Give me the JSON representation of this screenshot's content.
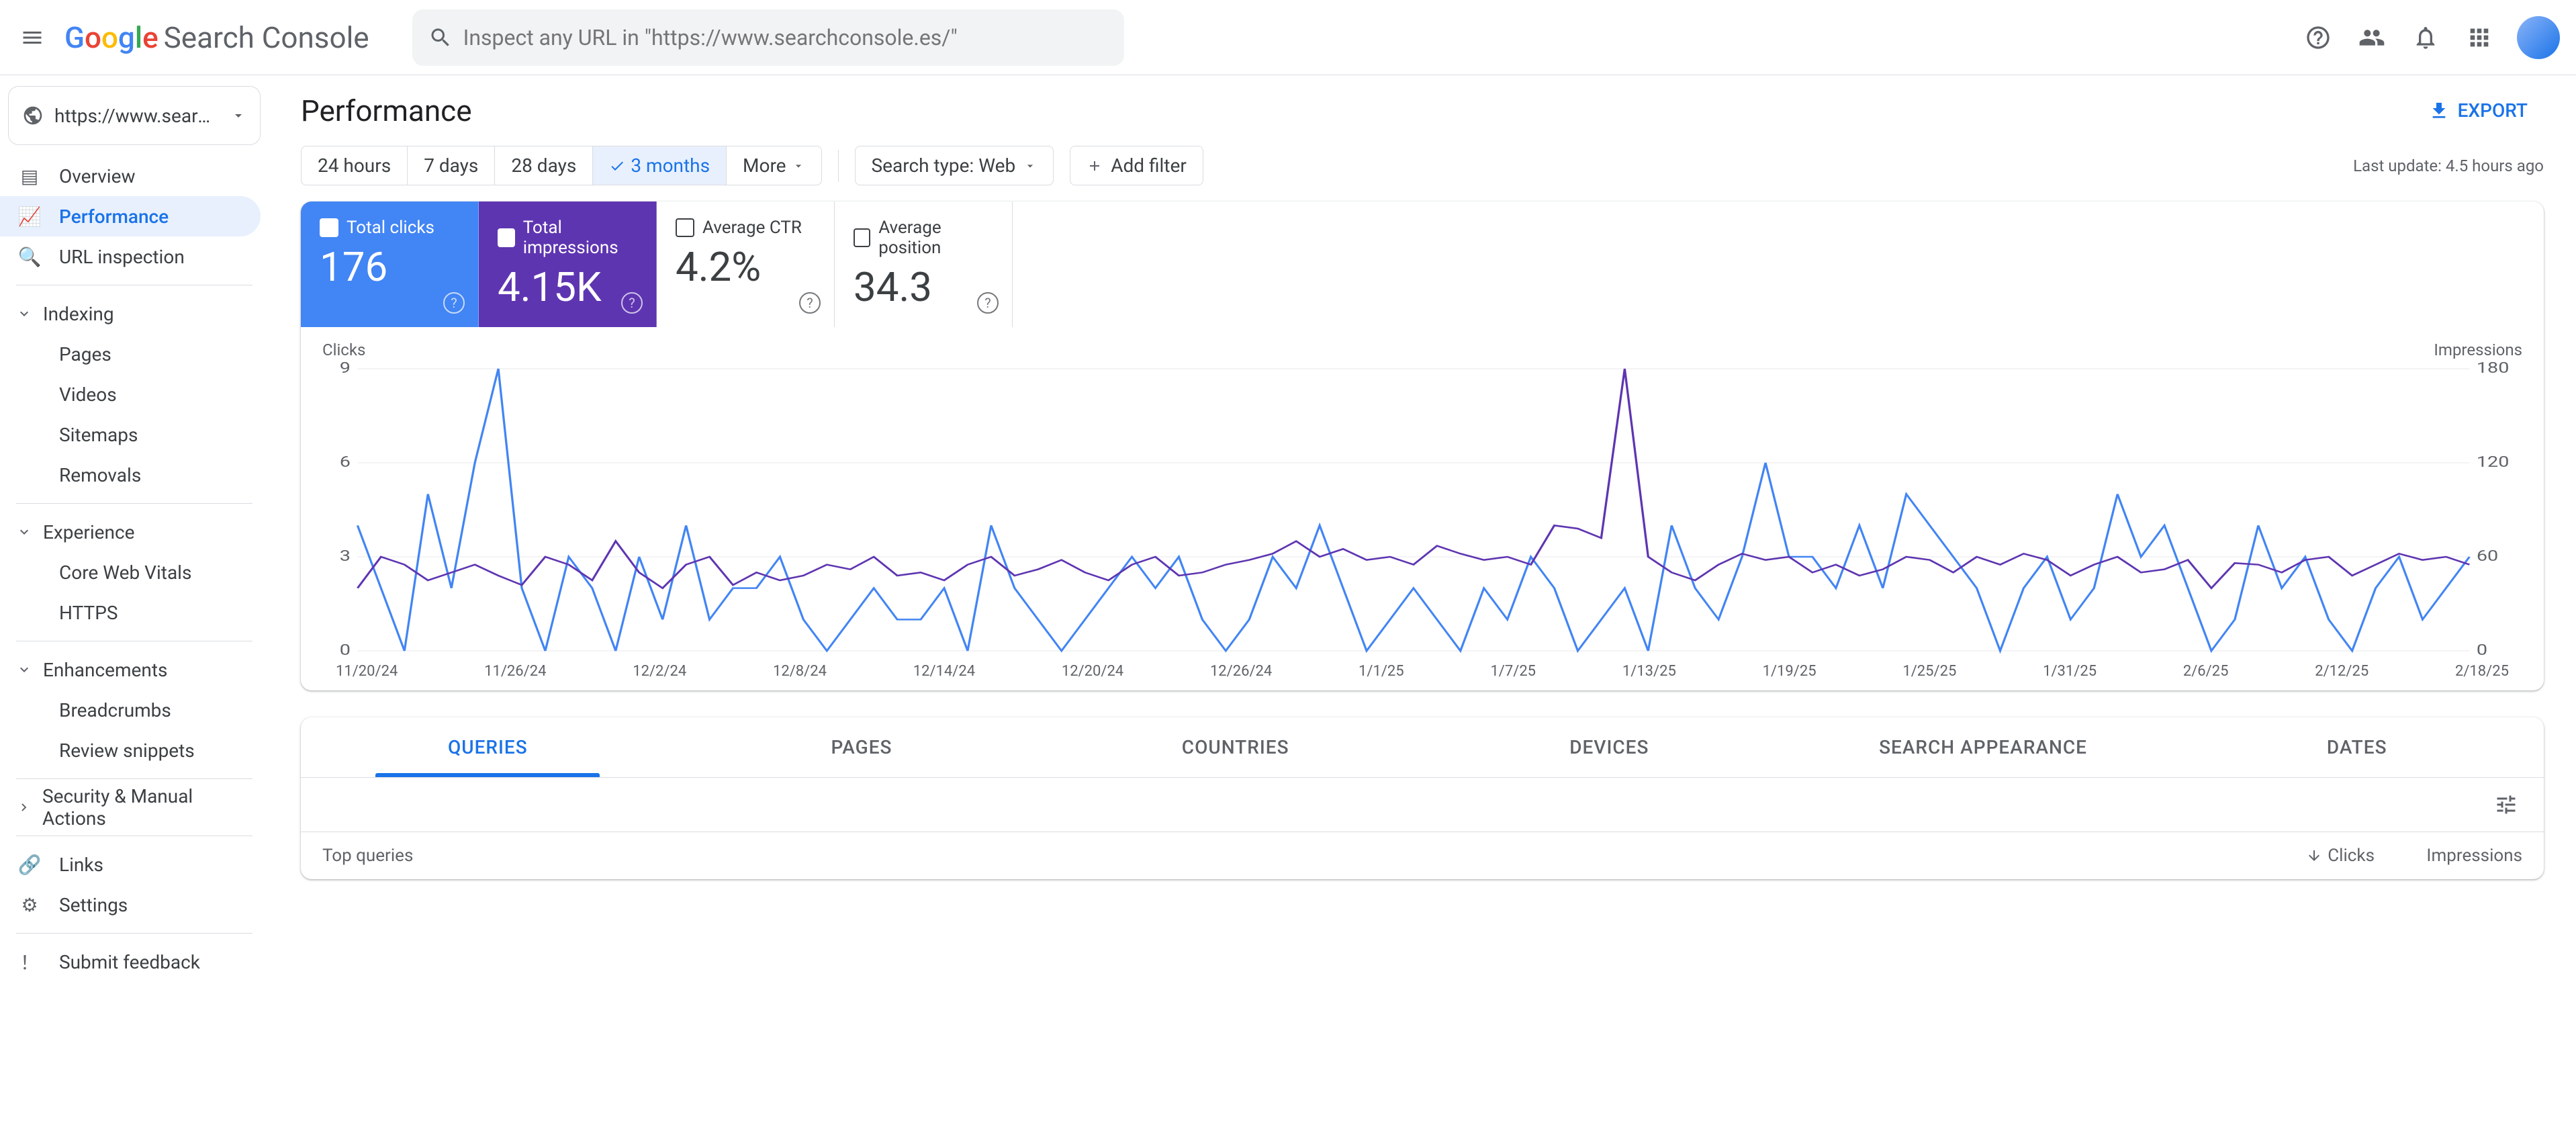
{
  "app_name": "Search Console",
  "search_placeholder": "Inspect any URL in \"https://www.searchconsole.es/\"",
  "property": "https://www.searchconsol...",
  "sidebar": {
    "overview": "Overview",
    "performance": "Performance",
    "url_inspection": "URL inspection",
    "indexing": "Indexing",
    "pages": "Pages",
    "videos": "Videos",
    "sitemaps": "Sitemaps",
    "removals": "Removals",
    "experience": "Experience",
    "core_web_vitals": "Core Web Vitals",
    "https": "HTTPS",
    "enhancements": "Enhancements",
    "breadcrumbs": "Breadcrumbs",
    "review_snippets": "Review snippets",
    "security": "Security & Manual Actions",
    "links": "Links",
    "settings": "Settings",
    "submit_feedback": "Submit feedback"
  },
  "page_title": "Performance",
  "export_label": "EXPORT",
  "date_ranges": {
    "h24": "24 hours",
    "d7": "7 days",
    "d28": "28 days",
    "m3": "3 months",
    "more": "More"
  },
  "search_type_label": "Search type: Web",
  "add_filter_label": "Add filter",
  "last_update": "Last update: 4.5 hours ago",
  "metrics": {
    "clicks": {
      "label": "Total clicks",
      "value": "176"
    },
    "impressions": {
      "label": "Total impressions",
      "value": "4.15K"
    },
    "ctr": {
      "label": "Average CTR",
      "value": "4.2%"
    },
    "position": {
      "label": "Average position",
      "value": "34.3"
    }
  },
  "chart_labels": {
    "left": "Clicks",
    "right": "Impressions"
  },
  "y_left": {
    "max": "9",
    "mid": "6",
    "low": "3",
    "min": "0"
  },
  "y_right": {
    "max": "180",
    "mid": "120",
    "low": "60",
    "min": "0"
  },
  "tabs": {
    "queries": "QUERIES",
    "pages": "PAGES",
    "countries": "COUNTRIES",
    "devices": "DEVICES",
    "search_appearance": "SEARCH APPEARANCE",
    "dates": "DATES"
  },
  "table": {
    "top_queries": "Top queries",
    "clicks": "Clicks",
    "impressions": "Impressions"
  },
  "chart_data": {
    "type": "line",
    "x": [
      "11/20/24",
      "11/26/24",
      "12/2/24",
      "12/8/24",
      "12/14/24",
      "12/20/24",
      "12/26/24",
      "1/1/25",
      "1/7/25",
      "1/13/25",
      "1/19/25",
      "1/25/25",
      "1/31/25",
      "2/6/25",
      "2/12/25",
      "2/18/25"
    ],
    "series": [
      {
        "name": "Clicks",
        "color": "#4285f4",
        "ylim": [
          0,
          9
        ],
        "values": [
          4,
          2,
          0,
          5,
          2,
          6,
          9,
          2,
          0,
          3,
          2,
          0,
          3,
          1,
          4,
          1,
          2,
          2,
          3,
          1,
          0,
          1,
          2,
          1,
          1,
          2,
          0,
          4,
          2,
          1,
          0,
          1,
          2,
          3,
          2,
          3,
          1,
          0,
          1,
          3,
          2,
          4,
          2,
          0,
          1,
          2,
          1,
          0,
          2,
          1,
          3,
          2,
          0,
          1,
          2,
          0,
          4,
          2,
          1,
          3,
          6,
          3,
          3,
          2,
          4,
          2,
          5,
          4,
          3,
          2,
          0,
          2,
          3,
          1,
          2,
          5,
          3,
          4,
          2,
          0,
          1,
          4,
          2,
          3,
          1,
          0,
          2,
          3,
          1,
          2,
          3
        ]
      },
      {
        "name": "Impressions",
        "color": "#5e35b1",
        "ylim": [
          0,
          180
        ],
        "values": [
          40,
          60,
          55,
          45,
          50,
          55,
          48,
          42,
          60,
          55,
          45,
          70,
          50,
          40,
          55,
          60,
          42,
          50,
          45,
          48,
          55,
          52,
          60,
          48,
          50,
          45,
          55,
          60,
          48,
          52,
          58,
          50,
          45,
          55,
          60,
          48,
          50,
          55,
          58,
          62,
          70,
          60,
          65,
          58,
          60,
          55,
          67,
          62,
          58,
          60,
          55,
          80,
          78,
          72,
          180,
          60,
          50,
          45,
          55,
          62,
          58,
          60,
          50,
          55,
          48,
          52,
          60,
          58,
          50,
          60,
          55,
          62,
          58,
          48,
          55,
          60,
          50,
          52,
          58,
          40,
          56,
          55,
          50,
          58,
          60,
          48,
          55,
          62,
          58,
          60,
          55
        ]
      }
    ]
  }
}
